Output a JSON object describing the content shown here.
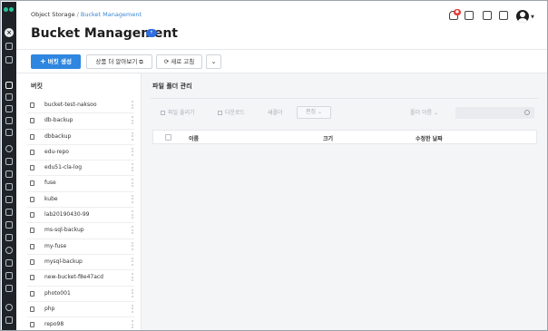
{
  "breadcrumb": {
    "root": "Object Storage",
    "separator": "/",
    "current": "Bucket Management"
  },
  "page": {
    "title": "Bucket Management",
    "badge": "↑"
  },
  "notifications": {
    "count": "●"
  },
  "toolbar": {
    "create_label": "버킷 생성",
    "details_label": "상품 더 알아보기",
    "refresh_label": "새로 고침"
  },
  "bucket_panel": {
    "title": "버킷",
    "items": [
      "bucket-test-naksoo",
      "db-backup",
      "dbbackup",
      "edu-repo",
      "edu51-cla-log",
      "fuse",
      "kube",
      "lab20190430-99",
      "ms-sql-backup",
      "my-fuse",
      "mysql-backup",
      "new-bucket-f8e47acd",
      "photo001",
      "php",
      "repo98"
    ]
  },
  "file_panel": {
    "title": "파일 폴더 관리",
    "upload_label": "파일 올리기",
    "download_label": "다운로드",
    "new_folder_label": "새폴더",
    "edit_label": "편집",
    "view_label": "폴더 이름",
    "columns": {
      "name": "이름",
      "size": "크기",
      "modified": "수정한 날짜"
    }
  },
  "icons": {
    "rail": [
      "close-icon",
      "grid-icon",
      "home-icon",
      "server-icon",
      "storage-icon",
      "database-icon",
      "network-icon",
      "security-icon",
      "monitor-icon",
      "settings-icon"
    ],
    "header": [
      "bell-icon",
      "cart-icon",
      "calendar-icon",
      "document-icon",
      "user-icon"
    ]
  },
  "colors": {
    "accent": "#2f86e0",
    "rail": "#1f2327",
    "brand": "#27c39a"
  }
}
